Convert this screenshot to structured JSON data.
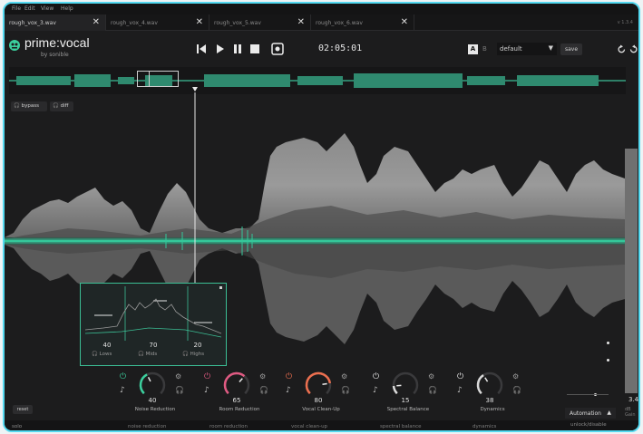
{
  "menu": [
    "File",
    "Edit",
    "View",
    "Help"
  ],
  "tabs": [
    {
      "label": "rough_vox_3.wav",
      "active": true
    },
    {
      "label": "rough_vox_4.wav",
      "active": false
    },
    {
      "label": "rough_vox_5.wav",
      "active": false
    },
    {
      "label": "rough_vox_6.wav",
      "active": false
    }
  ],
  "tab_close": "✕",
  "version": "v 1.3.4",
  "brand": {
    "name": "prime:vocal",
    "by": "by sonible"
  },
  "transport": {
    "timecode": "02:05:01"
  },
  "ab": {
    "a": "A",
    "b": "B"
  },
  "preset": {
    "value": "default",
    "arrow": "▼",
    "save": "save"
  },
  "monitor": {
    "bypass": "bypass",
    "diff": "diff"
  },
  "panel": {
    "values": [
      "40",
      "70",
      "20"
    ],
    "labels": [
      "Lows",
      "Mids",
      "Highs"
    ]
  },
  "modules": [
    {
      "name": "Noise Reduction",
      "value": "40",
      "amount": 0.4,
      "color": "#3bcf9d",
      "enabled": true
    },
    {
      "name": "Room Reduction",
      "value": "65",
      "amount": 0.65,
      "color": "#e05a82",
      "enabled": true
    },
    {
      "name": "Vocal Clean-Up",
      "value": "80",
      "amount": 0.8,
      "color": "#ec6f4f",
      "enabled": true
    },
    {
      "name": "Spectral Balance",
      "value": "15",
      "amount": 0.15,
      "color": "#d9d9d9",
      "enabled": true
    },
    {
      "name": "Dynamics",
      "value": "38",
      "amount": 0.38,
      "color": "#d9d9d9",
      "enabled": true
    }
  ],
  "reset": "reset",
  "statusbar": {
    "left": "solo",
    "items": [
      "noise reduction",
      "room reduction",
      "vocal clean-up",
      "spectral balance",
      "dynamics"
    ]
  },
  "automation": {
    "label": "Automation",
    "arrow": "▲",
    "sub": "unlock/disable"
  },
  "meter": {
    "value": "3.4",
    "sub": "dB Gain"
  },
  "colors": {
    "accent": "#3bcf9d",
    "frame": "#53d9f0",
    "wave": "#7d7d7d"
  }
}
